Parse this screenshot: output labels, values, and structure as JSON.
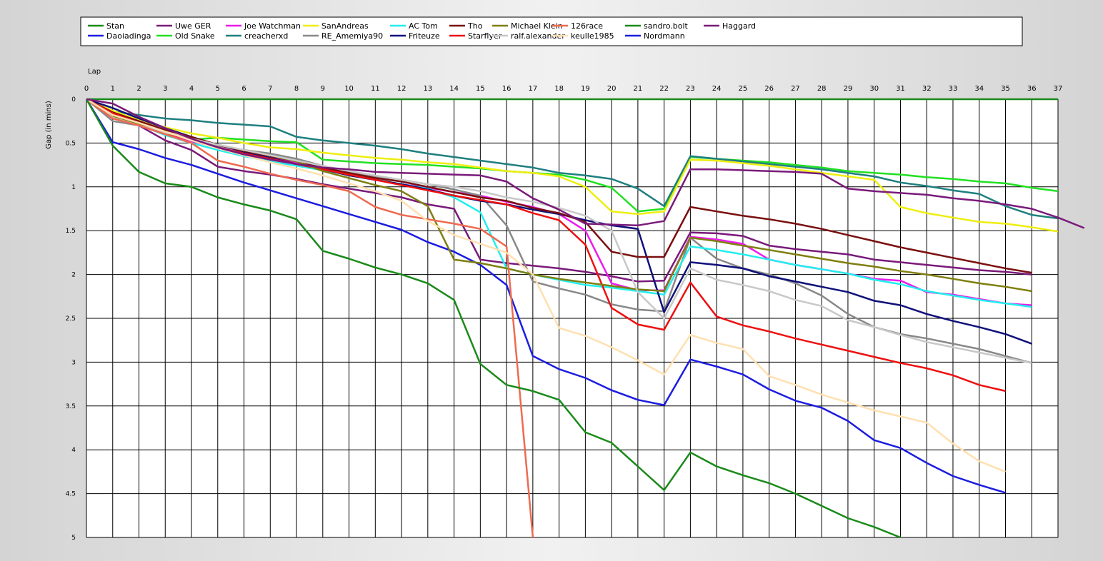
{
  "chart_data": {
    "type": "line",
    "xlabel": "Lap",
    "ylabel": "Gap (in mins)",
    "xlim": [
      0,
      37
    ],
    "ylim": [
      0,
      5
    ],
    "y_inverted": true,
    "grid": true,
    "legend_position": "top",
    "x_ticks": [
      0,
      1,
      2,
      3,
      4,
      5,
      6,
      7,
      8,
      9,
      10,
      11,
      12,
      13,
      14,
      15,
      16,
      17,
      18,
      19,
      20,
      21,
      22,
      23,
      24,
      25,
      26,
      27,
      28,
      29,
      30,
      31,
      32,
      33,
      34,
      35,
      36,
      37
    ],
    "y_ticks": [
      "0",
      "0.5",
      "1",
      "1.5",
      "2",
      "2.5",
      "3",
      "3.5",
      "4",
      "4.5",
      "5"
    ],
    "series": [
      {
        "name": "Stan",
        "color": "#1a8a1a",
        "values": [
          0,
          0,
          0,
          0,
          0,
          0,
          0,
          0,
          0,
          0,
          0,
          0,
          0,
          0,
          0,
          0,
          0,
          0,
          0,
          0,
          0,
          0,
          0,
          0,
          0,
          0,
          0,
          0,
          0,
          0,
          0,
          0,
          0,
          0,
          0,
          0,
          0,
          0
        ]
      },
      {
        "name": "Daoiadinga",
        "color": "#1c1ce0",
        "values": [
          0,
          0.49,
          0.57,
          0.67,
          0.75,
          0.85,
          0.95,
          1.04,
          1.13,
          1.22,
          1.31,
          1.4,
          1.49,
          1.63,
          1.74,
          1.89,
          2.12,
          2.93,
          3.08,
          3.18,
          3.32,
          3.43,
          3.49,
          2.97,
          3.05,
          3.14,
          3.31,
          3.44,
          3.52,
          3.67,
          3.89,
          3.98,
          4.15,
          4.3,
          4.4,
          4.49
        ]
      },
      {
        "name": "Uwe GER",
        "color": "#7a1a7a",
        "values": [
          0,
          0.18,
          0.3,
          0.47,
          0.58,
          0.77,
          0.82,
          0.86,
          0.91,
          0.97,
          1.02,
          1.07,
          1.12,
          1.2,
          1.25,
          1.83,
          1.87,
          1.9,
          1.93,
          1.97,
          2.02,
          2.08,
          2.07,
          1.52,
          1.53,
          1.56,
          1.67,
          1.71,
          1.74,
          1.77,
          1.83,
          1.86,
          1.89,
          1.92,
          1.95,
          1.97,
          2.0
        ]
      },
      {
        "name": "Old Snake",
        "color": "#22e022",
        "values": [
          0,
          0.15,
          0.27,
          0.38,
          0.46,
          0.44,
          0.46,
          0.48,
          0.49,
          0.69,
          0.71,
          0.73,
          0.74,
          0.75,
          0.77,
          0.79,
          0.82,
          0.84,
          0.86,
          0.92,
          1.01,
          1.28,
          1.25,
          0.66,
          0.68,
          0.7,
          0.72,
          0.75,
          0.78,
          0.82,
          0.84,
          0.86,
          0.89,
          0.91,
          0.94,
          0.96,
          1.01,
          1.05
        ]
      },
      {
        "name": "Joe Watchman",
        "color": "#ee1aee",
        "values": [
          0,
          0.2,
          0.3,
          0.4,
          0.48,
          0.55,
          0.62,
          0.67,
          0.73,
          0.79,
          0.86,
          0.92,
          0.97,
          1.01,
          1.06,
          1.1,
          1.17,
          1.23,
          1.31,
          1.5,
          2.1,
          2.18,
          2.18,
          1.57,
          1.6,
          1.65,
          1.83,
          1.89,
          1.94,
          1.99,
          2.05,
          2.07,
          2.2,
          2.23,
          2.28,
          2.33,
          2.35
        ]
      },
      {
        "name": "creacherxd",
        "color": "#1f7f7f",
        "values": [
          0,
          0.14,
          0.18,
          0.22,
          0.24,
          0.27,
          0.29,
          0.31,
          0.43,
          0.47,
          0.5,
          0.53,
          0.57,
          0.62,
          0.66,
          0.7,
          0.74,
          0.78,
          0.84,
          0.87,
          0.91,
          1.02,
          1.22,
          0.65,
          0.68,
          0.71,
          0.74,
          0.77,
          0.8,
          0.84,
          0.88,
          0.95,
          0.99,
          1.04,
          1.08,
          1.22,
          1.32,
          1.36
        ]
      },
      {
        "name": "SanAndreas",
        "color": "#eeee10",
        "values": [
          0,
          0.13,
          0.24,
          0.32,
          0.39,
          0.44,
          0.5,
          0.55,
          0.57,
          0.61,
          0.64,
          0.67,
          0.69,
          0.72,
          0.74,
          0.78,
          0.82,
          0.84,
          0.88,
          1.0,
          1.28,
          1.31,
          1.28,
          0.69,
          0.7,
          0.73,
          0.76,
          0.8,
          0.84,
          0.88,
          0.92,
          1.23,
          1.3,
          1.35,
          1.4,
          1.42,
          1.46,
          1.51
        ]
      },
      {
        "name": "RE_Amemiya90",
        "color": "#888888",
        "values": [
          0,
          0.25,
          0.3,
          0.38,
          0.47,
          0.53,
          0.58,
          0.62,
          0.68,
          0.76,
          0.82,
          0.88,
          0.92,
          0.97,
          1.03,
          1.1,
          1.44,
          2.08,
          2.16,
          2.23,
          2.34,
          2.4,
          2.42,
          1.58,
          1.82,
          1.93,
          2.0,
          2.1,
          2.24,
          2.45,
          2.6,
          2.68,
          2.73,
          2.79,
          2.85,
          2.93,
          3.01
        ]
      },
      {
        "name": "AC Tom",
        "color": "#22eeee",
        "values": [
          0,
          0.17,
          0.29,
          0.41,
          0.5,
          0.58,
          0.65,
          0.71,
          0.76,
          0.81,
          0.86,
          0.92,
          0.97,
          1.02,
          1.12,
          1.29,
          1.93,
          2.0,
          2.06,
          2.12,
          2.15,
          2.19,
          2.23,
          1.68,
          1.72,
          1.77,
          1.83,
          1.89,
          1.94,
          1.99,
          2.06,
          2.11,
          2.19,
          2.24,
          2.29,
          2.33,
          2.37
        ]
      },
      {
        "name": "Friteuze",
        "color": "#10107a",
        "values": [
          0,
          0.1,
          0.22,
          0.33,
          0.43,
          0.52,
          0.6,
          0.67,
          0.74,
          0.8,
          0.87,
          0.92,
          0.97,
          1.03,
          1.1,
          1.16,
          1.2,
          1.26,
          1.31,
          1.38,
          1.44,
          1.48,
          2.43,
          1.86,
          1.89,
          1.93,
          2.02,
          2.08,
          2.14,
          2.2,
          2.3,
          2.35,
          2.45,
          2.53,
          2.6,
          2.68,
          2.79
        ]
      },
      {
        "name": "Tho",
        "color": "#7a0f0f",
        "values": [
          0,
          0.15,
          0.25,
          0.35,
          0.43,
          0.52,
          0.59,
          0.65,
          0.71,
          0.78,
          0.84,
          0.9,
          0.94,
          1.0,
          1.06,
          1.12,
          1.16,
          1.24,
          1.3,
          1.4,
          1.74,
          1.8,
          1.8,
          1.23,
          1.28,
          1.33,
          1.37,
          1.42,
          1.48,
          1.55,
          1.62,
          1.69,
          1.75,
          1.81,
          1.87,
          1.93,
          1.98
        ]
      },
      {
        "name": "Starflyer",
        "color": "#ee1010",
        "values": [
          0,
          0.16,
          0.27,
          0.38,
          0.47,
          0.55,
          0.62,
          0.68,
          0.74,
          0.8,
          0.86,
          0.92,
          0.98,
          1.04,
          1.1,
          1.15,
          1.2,
          1.3,
          1.38,
          1.66,
          2.38,
          2.57,
          2.63,
          2.09,
          2.48,
          2.58,
          2.65,
          2.73,
          2.8,
          2.87,
          2.94,
          3.01,
          3.07,
          3.15,
          3.26,
          3.33
        ]
      },
      {
        "name": "Michael Klein",
        "color": "#7f7f10",
        "values": [
          0,
          0.2,
          0.28,
          0.38,
          0.45,
          0.52,
          0.58,
          0.64,
          0.71,
          0.82,
          0.9,
          0.98,
          1.05,
          1.22,
          1.83,
          1.87,
          1.93,
          2.0,
          2.05,
          2.09,
          2.13,
          2.17,
          2.19,
          1.58,
          1.62,
          1.67,
          1.72,
          1.77,
          1.82,
          1.87,
          1.91,
          1.96,
          2.0,
          2.05,
          2.1,
          2.14,
          2.19
        ]
      },
      {
        "name": "ralf.alexander",
        "color": "#c8c8c8",
        "values": [
          0,
          0.21,
          0.3,
          0.38,
          0.45,
          0.52,
          0.58,
          0.64,
          0.7,
          0.76,
          0.82,
          0.87,
          0.92,
          0.97,
          1.0,
          1.05,
          1.12,
          1.17,
          1.24,
          1.33,
          1.5,
          2.2,
          2.5,
          1.93,
          2.06,
          2.12,
          2.19,
          2.29,
          2.36,
          2.52,
          2.6,
          2.69,
          2.77,
          2.83,
          2.89,
          2.95,
          3.01
        ]
      },
      {
        "name": "126race",
        "color": "#ee6a50",
        "values": [
          0,
          0.22,
          0.3,
          0.4,
          0.5,
          0.7,
          0.77,
          0.85,
          0.92,
          0.98,
          1.05,
          1.23,
          1.32,
          1.37,
          1.42,
          1.48,
          1.68,
          5.0
        ]
      },
      {
        "name": "keulle1985",
        "color": "#ffe0b0",
        "values": [
          0,
          0.18,
          0.27,
          0.37,
          0.47,
          0.56,
          0.64,
          0.72,
          0.79,
          0.87,
          0.96,
          1.05,
          1.16,
          1.39,
          1.55,
          1.65,
          1.75,
          2.0,
          2.61,
          2.7,
          2.83,
          2.98,
          3.14,
          2.69,
          2.78,
          2.85,
          3.16,
          3.26,
          3.37,
          3.46,
          3.55,
          3.62,
          3.69,
          3.93,
          4.13,
          4.25
        ]
      },
      {
        "name": "sandro.bolt",
        "color": "#1a8a1a",
        "values": [
          0,
          0.53,
          0.83,
          0.96,
          1.0,
          1.12,
          1.2,
          1.27,
          1.37,
          1.73,
          1.82,
          1.92,
          2.0,
          2.1,
          2.29,
          3.02,
          3.26,
          3.33,
          3.43,
          3.8,
          3.92,
          4.19,
          4.46,
          4.03,
          4.19,
          4.29,
          4.38,
          4.5,
          4.64,
          4.78,
          4.88,
          5.0
        ]
      },
      {
        "name": "Nordmann",
        "color": "#1c1ce0",
        "values": []
      },
      {
        "name": "Haggard",
        "color": "#7a1a7a",
        "values": [
          0,
          0.05,
          0.2,
          0.33,
          0.45,
          0.55,
          0.63,
          0.69,
          0.74,
          0.78,
          0.8,
          0.83,
          0.84,
          0.85,
          0.86,
          0.87,
          0.94,
          1.13,
          1.26,
          1.42,
          1.43,
          1.44,
          1.39,
          0.8,
          0.8,
          0.81,
          0.82,
          0.83,
          0.85,
          1.02,
          1.05,
          1.07,
          1.09,
          1.13,
          1.16,
          1.2,
          1.25,
          1.35,
          1.47
        ]
      }
    ]
  }
}
